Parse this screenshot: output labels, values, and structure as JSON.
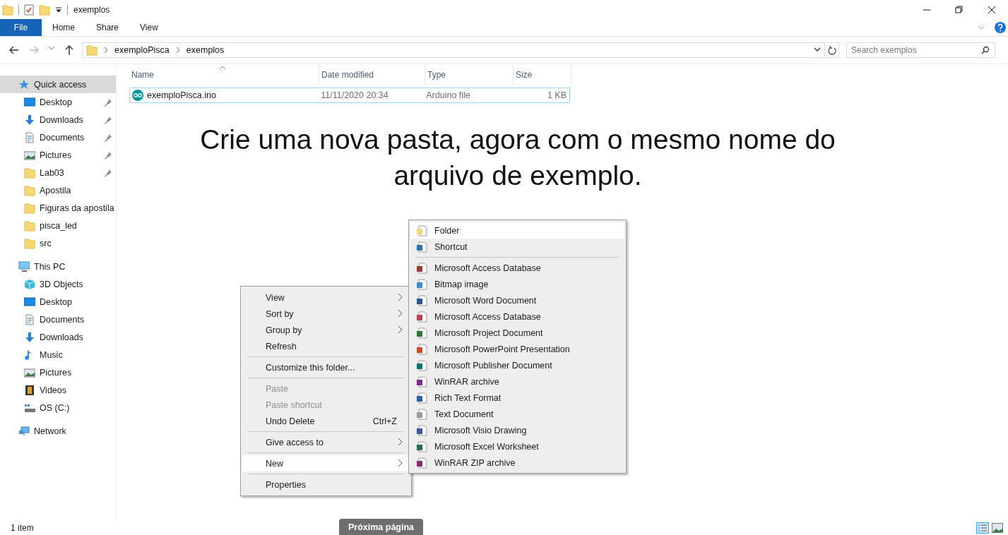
{
  "window": {
    "title": "exemplos"
  },
  "ribbon_tabs": [
    {
      "label": "File",
      "selected": true
    },
    {
      "label": "Home",
      "selected": false
    },
    {
      "label": "Share",
      "selected": false
    },
    {
      "label": "View",
      "selected": false
    }
  ],
  "address": {
    "path": [
      "exemploPisca",
      "exemplos"
    ]
  },
  "search": {
    "placeholder": "Search exemplos"
  },
  "sidebar": {
    "items": [
      {
        "label": "Quick access",
        "selected": true,
        "children": [
          {
            "label": "Desktop",
            "pinned": true,
            "selected": false
          },
          {
            "label": "Downloads",
            "pinned": true,
            "selected": false
          },
          {
            "label": "Documents",
            "pinned": true,
            "selected": false
          },
          {
            "label": "Pictures",
            "pinned": true,
            "selected": false
          },
          {
            "label": "Lab03",
            "pinned": true,
            "selected": false
          },
          {
            "label": "Apostila",
            "pinned": false,
            "selected": false
          },
          {
            "label": "Figuras da apostila",
            "pinned": false,
            "selected": false
          },
          {
            "label": "pisca_led",
            "pinned": false,
            "selected": false
          },
          {
            "label": "src",
            "pinned": false,
            "selected": false
          }
        ]
      },
      {
        "label": "This PC",
        "selected": false,
        "children": [
          {
            "label": "3D Objects",
            "pinned": false,
            "selected": false
          },
          {
            "label": "Desktop",
            "pinned": false,
            "selected": false
          },
          {
            "label": "Documents",
            "pinned": false,
            "selected": false
          },
          {
            "label": "Downloads",
            "pinned": false,
            "selected": false
          },
          {
            "label": "Music",
            "pinned": false,
            "selected": false
          },
          {
            "label": "Pictures",
            "pinned": false,
            "selected": false
          },
          {
            "label": "Videos",
            "pinned": false,
            "selected": false
          },
          {
            "label": "OS (C:)",
            "pinned": false,
            "selected": false
          }
        ]
      },
      {
        "label": "Network",
        "selected": false
      }
    ]
  },
  "table": {
    "columns": [
      "Name",
      "Date modified",
      "Type",
      "Size"
    ],
    "rows": [
      {
        "cells": [
          "exemploPisca.ino",
          "11/11/2020 20:34",
          "Arduino file",
          "1 KB"
        ],
        "focused": true
      }
    ]
  },
  "caption": "Crie uma nova pasta, agora com o mesmo nome do arquivo de exemplo.",
  "context_menu": {
    "items": [
      {
        "kind": "item",
        "label": "View",
        "submenu": true,
        "disabled": false,
        "highlighted": false
      },
      {
        "kind": "item",
        "label": "Sort by",
        "submenu": true,
        "disabled": false,
        "highlighted": false
      },
      {
        "kind": "item",
        "label": "Group by",
        "submenu": true,
        "disabled": false,
        "highlighted": false
      },
      {
        "kind": "item",
        "label": "Refresh",
        "submenu": false,
        "disabled": false,
        "highlighted": false
      },
      {
        "kind": "separator"
      },
      {
        "kind": "item",
        "label": "Customize this folder...",
        "submenu": false,
        "disabled": false,
        "highlighted": false
      },
      {
        "kind": "separator"
      },
      {
        "kind": "item",
        "label": "Paste",
        "submenu": false,
        "disabled": true,
        "highlighted": false
      },
      {
        "kind": "item",
        "label": "Paste shortcut",
        "submenu": false,
        "disabled": true,
        "highlighted": false
      },
      {
        "kind": "item",
        "label": "Undo Delete",
        "shortcut": "Ctrl+Z",
        "submenu": false,
        "disabled": false,
        "highlighted": false
      },
      {
        "kind": "separator"
      },
      {
        "kind": "item",
        "label": "Give access to",
        "submenu": true,
        "disabled": false,
        "highlighted": false
      },
      {
        "kind": "separator"
      },
      {
        "kind": "item",
        "label": "New",
        "submenu": true,
        "disabled": false,
        "highlighted": true
      },
      {
        "kind": "separator"
      },
      {
        "kind": "item",
        "label": "Properties",
        "submenu": false,
        "disabled": false,
        "highlighted": false
      }
    ]
  },
  "new_submenu": {
    "items": [
      {
        "kind": "item",
        "label": "Folder",
        "highlighted": true,
        "color": "#f8d775"
      },
      {
        "kind": "item",
        "label": "Shortcut",
        "highlighted": false,
        "color": "#2f6db5"
      },
      {
        "kind": "separator"
      },
      {
        "kind": "item",
        "label": "Microsoft Access Database",
        "highlighted": false,
        "color": "#a4373a"
      },
      {
        "kind": "item",
        "label": "Bitmap image",
        "highlighted": false,
        "color": "#3c8fd6"
      },
      {
        "kind": "item",
        "label": "Microsoft Word Document",
        "highlighted": false,
        "color": "#2b579a"
      },
      {
        "kind": "item",
        "label": "Microsoft Access Database",
        "highlighted": false,
        "color": "#c43e56"
      },
      {
        "kind": "item",
        "label": "Microsoft Project Document",
        "highlighted": false,
        "color": "#31752f"
      },
      {
        "kind": "item",
        "label": "Microsoft PowerPoint Presentation",
        "highlighted": false,
        "color": "#d24726"
      },
      {
        "kind": "item",
        "label": "Microsoft Publisher Document",
        "highlighted": false,
        "color": "#077568"
      },
      {
        "kind": "item",
        "label": "WinRAR archive",
        "highlighted": false,
        "color": "#7b2c8a"
      },
      {
        "kind": "item",
        "label": "Rich Text Format",
        "highlighted": false,
        "color": "#2b5fb0"
      },
      {
        "kind": "item",
        "label": "Text Document",
        "highlighted": false,
        "color": "#9a9a9a"
      },
      {
        "kind": "item",
        "label": "Microsoft Visio Drawing",
        "highlighted": false,
        "color": "#3955a3"
      },
      {
        "kind": "item",
        "label": "Microsoft Excel Worksheet",
        "highlighted": false,
        "color": "#217346"
      },
      {
        "kind": "item",
        "label": "WinRAR ZIP archive",
        "highlighted": false,
        "color": "#8a2c7a"
      }
    ]
  },
  "status_bar": {
    "item_count": "1 item"
  },
  "next_page_button": {
    "label": "Próxima página"
  }
}
